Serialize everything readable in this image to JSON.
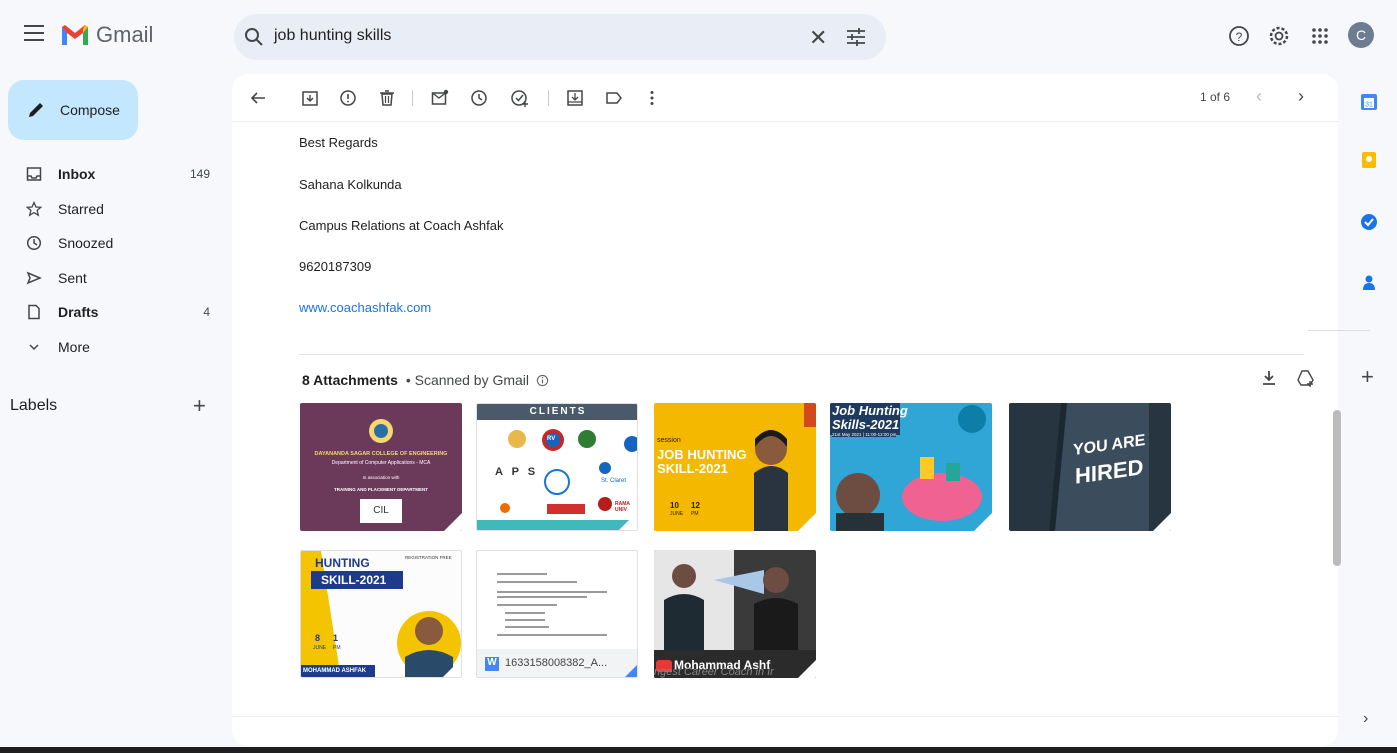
{
  "app": {
    "name": "Gmail",
    "avatar_initial": "C"
  },
  "search": {
    "query": "job hunting skills"
  },
  "compose": {
    "label": "Compose"
  },
  "nav": [
    {
      "label": "Inbox",
      "count": "149",
      "bold": true,
      "icon": "inbox-icon"
    },
    {
      "label": "Starred",
      "count": "",
      "bold": false,
      "icon": "star-icon"
    },
    {
      "label": "Snoozed",
      "count": "",
      "bold": false,
      "icon": "clock-icon"
    },
    {
      "label": "Sent",
      "count": "",
      "bold": false,
      "icon": "send-icon"
    },
    {
      "label": "Drafts",
      "count": "4",
      "bold": true,
      "icon": "draft-icon"
    },
    {
      "label": "More",
      "count": "",
      "bold": false,
      "icon": "chevron-down-icon"
    }
  ],
  "labels": {
    "title": "Labels"
  },
  "toolbar": {
    "pager": "1 of 6"
  },
  "email": {
    "signature": [
      "Best Regards",
      "Sahana Kolkunda",
      "Campus Relations at Coach Ashfak",
      "9620187309"
    ],
    "link": "www.coachashfak.com"
  },
  "attachments": {
    "title": "8 Attachments",
    "scanned": "• Scanned by Gmail",
    "items": [
      {
        "kind": "college",
        "text1": "DAYANANDA SAGAR COLLEGE OF ENGINEERING",
        "text2": "Department of Computer Applications - MCA",
        "text3": "In association with",
        "text4": "TRAINING AND PLACEMENT DEPARTMENT",
        "text5": "CIL"
      },
      {
        "kind": "clients",
        "text1": "CLIENTS",
        "text2": "A P S",
        "text3": "St. Claret",
        "text4": "RV",
        "text5": "RAMA UNIV"
      },
      {
        "kind": "poster1",
        "text1": "session",
        "text2": "JOB HUNTING",
        "text3": "SKILL-2021",
        "text4": "10",
        "text5": "JUNE",
        "text6": "12",
        "text7": "PM"
      },
      {
        "kind": "poster2",
        "text1": "Job Hunting",
        "text2": "Skills-2021",
        "text3": "21st May 2021 | 11:00-12:00 pm"
      },
      {
        "kind": "book",
        "text1": "YOU ARE",
        "text2": "HIRED"
      },
      {
        "kind": "poster3",
        "text1": "HUNTING",
        "text2": "SKILL-2021",
        "text3": "REGISTRATION FREE",
        "text4": "8",
        "text5": "JUNE",
        "text6": "1",
        "text7": "PM",
        "text8": "MOHAMMAD ASHFAK"
      },
      {
        "kind": "doc",
        "text1": "1633158008382_A..."
      },
      {
        "kind": "video",
        "text1": "Mohammad Ashf",
        "text2": "ngest Career Coach in Ir"
      }
    ]
  },
  "colors": {
    "accent": "#c2e7ff",
    "link": "#1a73e8",
    "bg": "#f6f8fc"
  }
}
